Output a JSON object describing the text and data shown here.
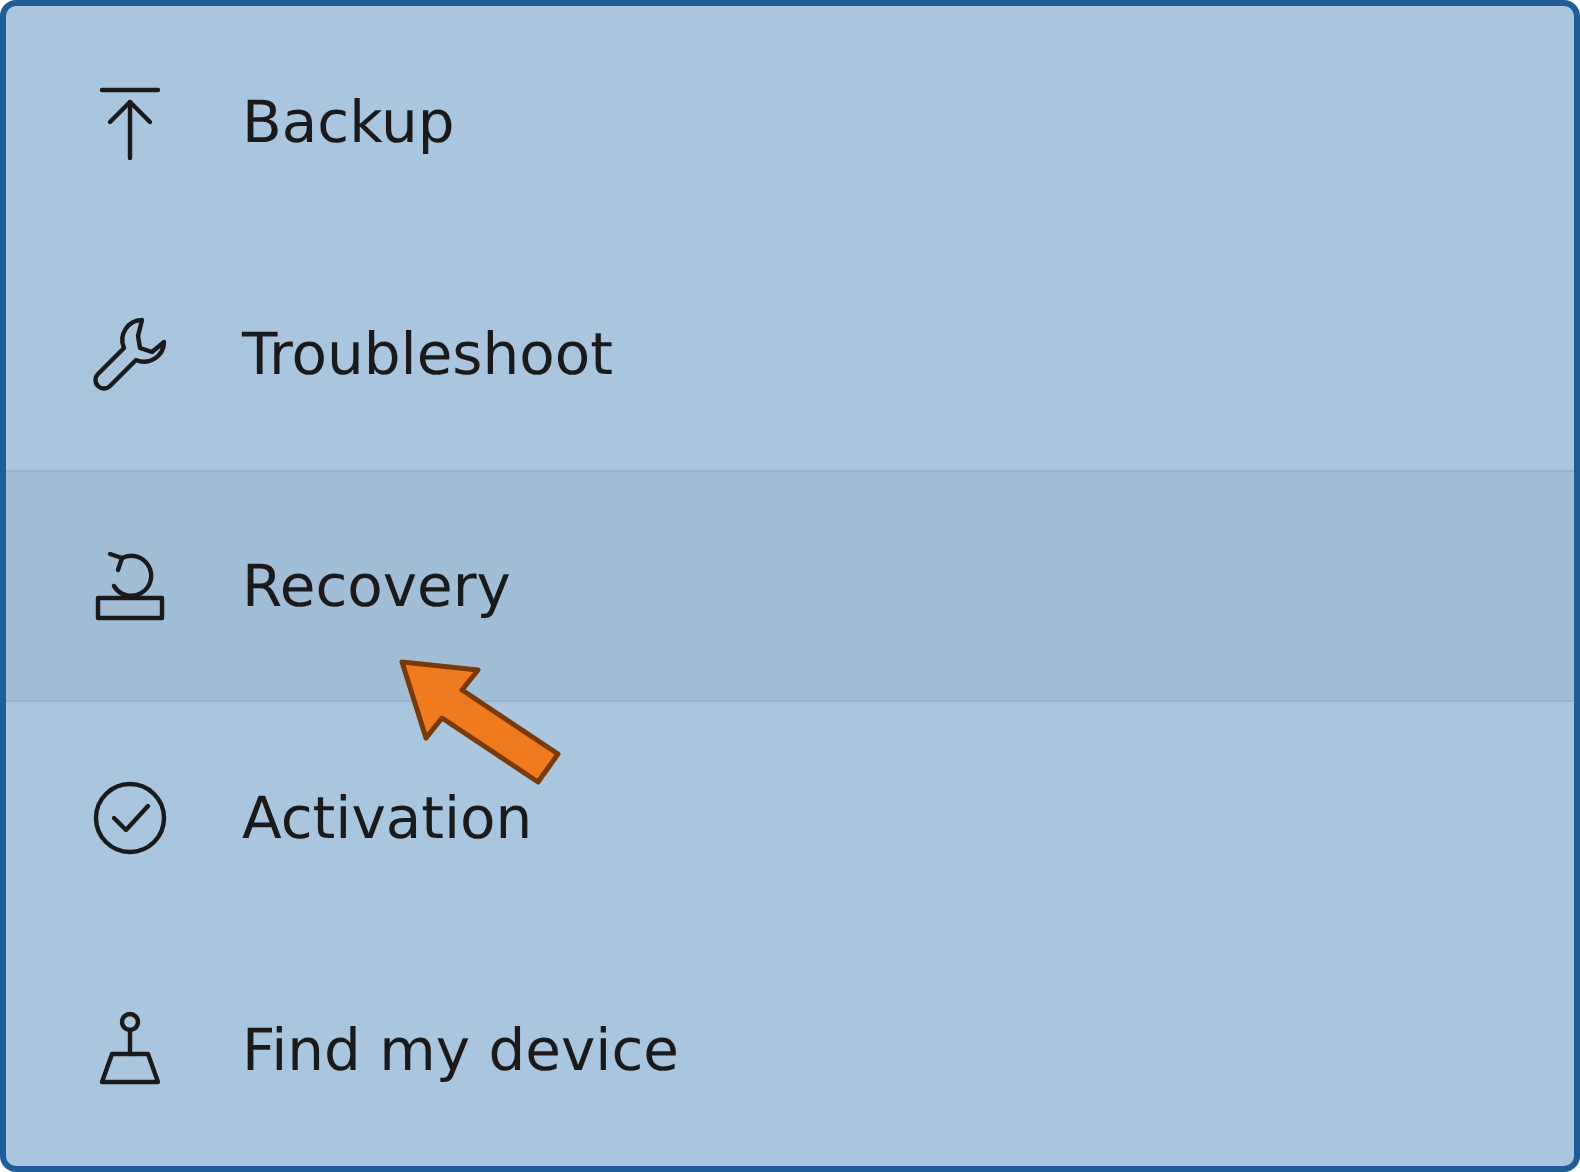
{
  "menu": {
    "items": [
      {
        "label": "Backup",
        "selected": false
      },
      {
        "label": "Troubleshoot",
        "selected": false
      },
      {
        "label": "Recovery",
        "selected": true
      },
      {
        "label": "Activation",
        "selected": false
      },
      {
        "label": "Find my device",
        "selected": false
      }
    ]
  }
}
